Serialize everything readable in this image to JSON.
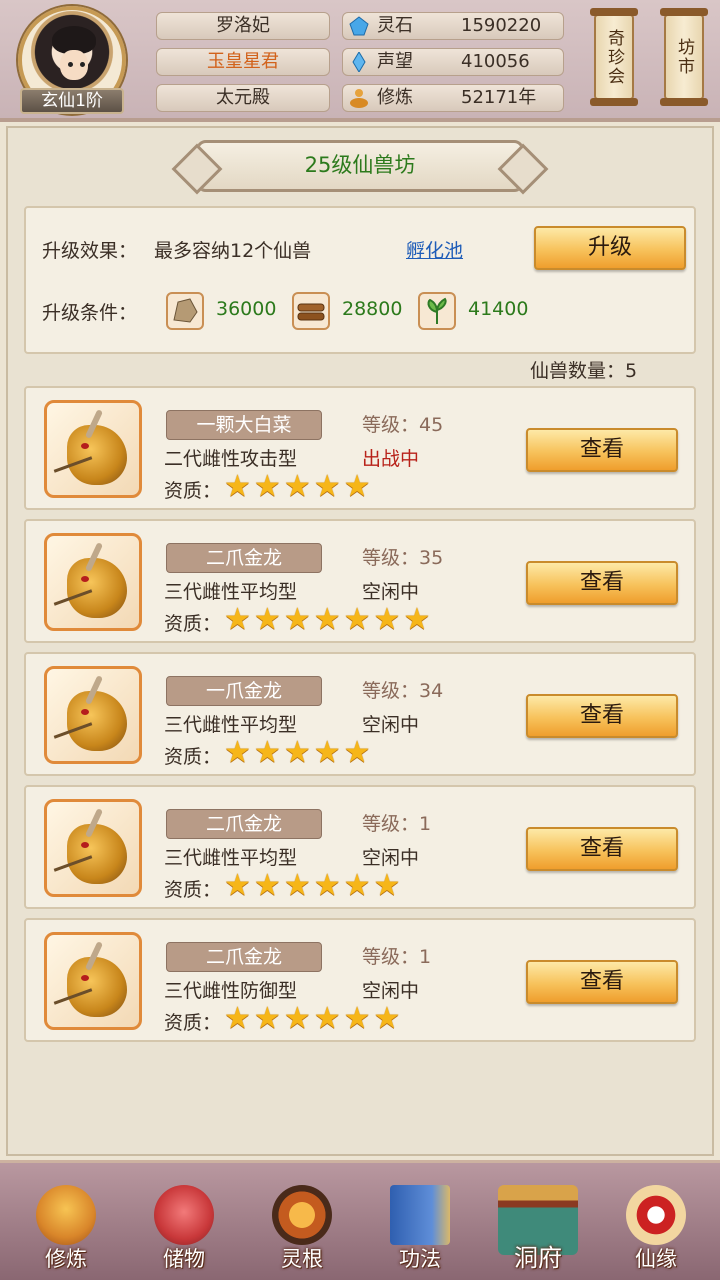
{
  "header": {
    "rank": "玄仙1阶",
    "name": "罗洛妃",
    "title": "玉皇星君",
    "hall": "太元殿",
    "stats": [
      {
        "label": "灵石",
        "value": "1590220",
        "icon": "spirit-stone-icon"
      },
      {
        "label": "声望",
        "value": "410056",
        "icon": "reputation-crystal-icon"
      },
      {
        "label": "修炼",
        "value": "52171年",
        "icon": "cultivation-meditation-icon"
      }
    ],
    "shortcuts": [
      "奇珍会",
      "坊市"
    ]
  },
  "panel": {
    "title": "25级仙兽坊",
    "upgrade_effect_label": "升级效果：",
    "upgrade_effect": "最多容纳12个仙兽",
    "hatch_link": "孵化池",
    "upgrade_button": "升级",
    "upgrade_cond_label": "升级条件：",
    "materials": [
      {
        "icon": "ore-icon",
        "value": "36000"
      },
      {
        "icon": "wood-icon",
        "value": "28800"
      },
      {
        "icon": "herb-icon",
        "value": "41400"
      }
    ],
    "beast_count": "仙兽数量：5"
  },
  "beasts": [
    {
      "name": "一颗大白菜",
      "level": "等级：45",
      "type": "二代雌性攻击型",
      "status": "出战中",
      "status_color": "#b8221a",
      "quality_label": "资质：",
      "stars": 5,
      "view": "查看"
    },
    {
      "name": "二爪金龙",
      "level": "等级：35",
      "type": "三代雌性平均型",
      "status": "空闲中",
      "status_color": "#3b2f26",
      "quality_label": "资质：",
      "stars": 7,
      "view": "查看"
    },
    {
      "name": "一爪金龙",
      "level": "等级：34",
      "type": "三代雌性平均型",
      "status": "空闲中",
      "status_color": "#3b2f26",
      "quality_label": "资质：",
      "stars": 5,
      "view": "查看"
    },
    {
      "name": "二爪金龙",
      "level": "等级：1",
      "type": "三代雌性平均型",
      "status": "空闲中",
      "status_color": "#3b2f26",
      "quality_label": "资质：",
      "stars": 6,
      "view": "查看"
    },
    {
      "name": "二爪金龙",
      "level": "等级：1",
      "type": "三代雌性防御型",
      "status": "空闲中",
      "status_color": "#3b2f26",
      "quality_label": "资质：",
      "stars": 6,
      "view": "查看"
    }
  ],
  "nav": [
    {
      "label": "修炼",
      "icon": "cultivation-icon"
    },
    {
      "label": "储物",
      "icon": "storage-bag-icon"
    },
    {
      "label": "灵根",
      "icon": "spirit-root-icon"
    },
    {
      "label": "功法",
      "icon": "technique-book-icon"
    },
    {
      "label": "洞府",
      "icon": "cave-mansion-icon"
    },
    {
      "label": "仙缘",
      "icon": "immortal-fate-icon"
    }
  ]
}
